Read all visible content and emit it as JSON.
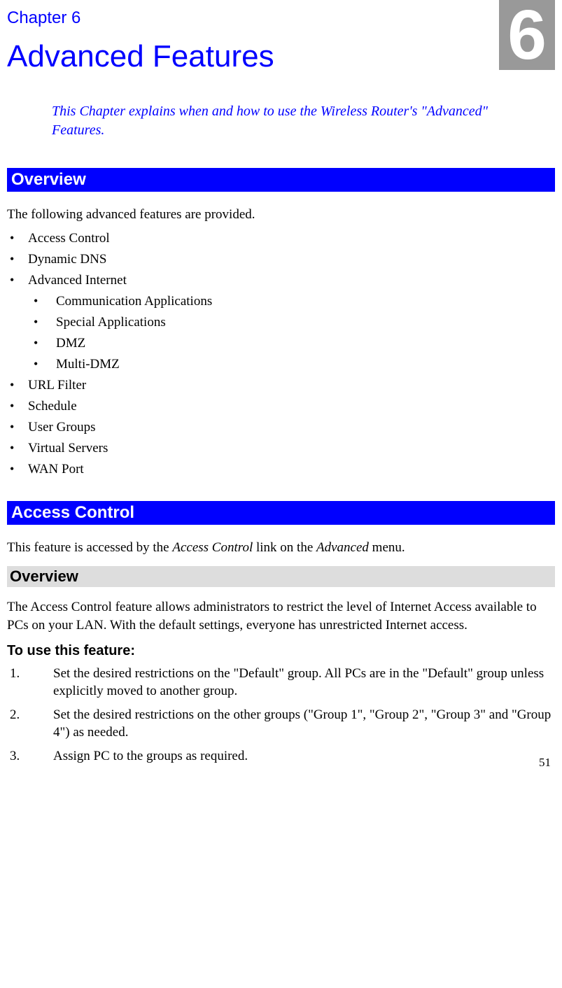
{
  "chapter": {
    "badge": "6",
    "label": "Chapter 6",
    "title": "Advanced Features",
    "subtitle": "This Chapter explains when and how to use the Wireless Router's \"Advanced\" Features."
  },
  "overview": {
    "heading": "Overview",
    "intro": "The following advanced features are provided.",
    "items": [
      "Access Control",
      "Dynamic DNS",
      "Advanced Internet",
      "URL Filter",
      "Schedule",
      "User Groups",
      "Virtual Servers",
      "WAN Port"
    ],
    "advanced_internet_sub": [
      "Communication Applications",
      "Special Applications",
      "DMZ",
      "Multi-DMZ"
    ]
  },
  "access_control": {
    "heading": "Access Control",
    "intro_pre": "This feature is accessed by the ",
    "intro_em1": "Access Control",
    "intro_mid": " link on the ",
    "intro_em2": "Advanced",
    "intro_post": " menu.",
    "sub_heading": "Overview",
    "description": "The Access Control feature allows administrators to restrict the level of Internet Access available to PCs on your LAN. With the default settings, everyone has unrestricted Internet access.",
    "use_heading": "To use this feature:",
    "steps": [
      "Set the desired restrictions on the \"Default\" group. All PCs are in the \"Default\" group unless explicitly moved to another group.",
      "Set the desired restrictions on the other groups (\"Group 1\", \"Group 2\", \"Group 3\" and \"Group 4\") as needed.",
      "Assign PC to the groups as required."
    ]
  },
  "page_number": "51"
}
